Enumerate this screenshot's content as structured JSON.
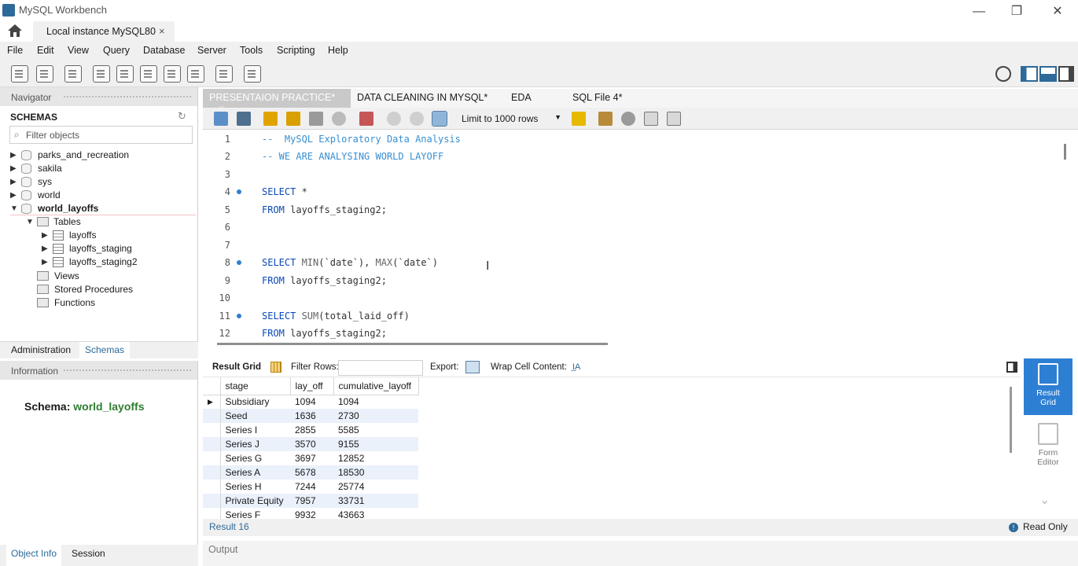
{
  "window": {
    "title": "MySQL Workbench",
    "controls": [
      "—",
      "❐",
      "✕"
    ]
  },
  "connection_tab": {
    "label": "Local instance MySQL80",
    "close": "×"
  },
  "menu": [
    "File",
    "Edit",
    "View",
    "Query",
    "Database",
    "Server",
    "Tools",
    "Scripting",
    "Help"
  ],
  "navigator": {
    "header": "Navigator",
    "schemas_label": "SCHEMAS",
    "filter_placeholder": "Filter objects",
    "schemas": [
      "parks_and_recreation",
      "sakila",
      "sys",
      "world",
      "world_layoffs"
    ],
    "selected_schema": "world_layoffs",
    "children": {
      "tables": "Tables",
      "views": "Views",
      "procedures": "Stored Procedures",
      "functions": "Functions"
    },
    "tables": [
      "layoffs",
      "layoffs_staging",
      "layoffs_staging2"
    ]
  },
  "subtabs": {
    "administration": "Administration",
    "schemas": "Schemas"
  },
  "information": {
    "header": "Information",
    "schema_label": "Schema:",
    "schema_value": "world_layoffs"
  },
  "bottom_tabs": {
    "object_info": "Object Info",
    "session": "Session"
  },
  "editor_tabs": [
    "PRESENTAION PRACTICE*",
    "DATA CLEANING IN MYSQL*",
    "EDA",
    "SQL File 4*"
  ],
  "sql_toolbar": {
    "limit_label": "Limit to 1000 rows"
  },
  "code_lines": [
    {
      "n": "1",
      "dot": false,
      "parts": [
        [
          "cm",
          "--  MySQL Exploratory Data Analysis"
        ]
      ]
    },
    {
      "n": "2",
      "dot": false,
      "parts": [
        [
          "cm",
          "-- WE ARE ANALYSING WORLD LAYOFF"
        ]
      ]
    },
    {
      "n": "3",
      "dot": false,
      "parts": []
    },
    {
      "n": "4",
      "dot": true,
      "parts": [
        [
          "kw",
          "SELECT"
        ],
        [
          "str",
          " *"
        ]
      ]
    },
    {
      "n": "5",
      "dot": false,
      "parts": [
        [
          "kw",
          "FROM"
        ],
        [
          "str",
          " layoffs_staging2;"
        ]
      ]
    },
    {
      "n": "6",
      "dot": false,
      "parts": []
    },
    {
      "n": "7",
      "dot": false,
      "parts": []
    },
    {
      "n": "8",
      "dot": true,
      "parts": [
        [
          "kw",
          "SELECT "
        ],
        [
          "fn",
          "MIN"
        ],
        [
          "str",
          "(`date`), "
        ],
        [
          "fn",
          "MAX"
        ],
        [
          "str",
          "(`date`)"
        ]
      ]
    },
    {
      "n": "9",
      "dot": false,
      "parts": [
        [
          "kw",
          "FROM"
        ],
        [
          "str",
          " layoffs_staging2;"
        ]
      ]
    },
    {
      "n": "10",
      "dot": false,
      "parts": []
    },
    {
      "n": "11",
      "dot": true,
      "parts": [
        [
          "kw",
          "SELECT "
        ],
        [
          "fn",
          "SUM"
        ],
        [
          "str",
          "(total_laid_off)"
        ]
      ]
    },
    {
      "n": "12",
      "dot": false,
      "parts": [
        [
          "kw",
          "FROM"
        ],
        [
          "str",
          " layoffs_staging2;"
        ]
      ]
    }
  ],
  "result_toolbar": {
    "result_grid": "Result Grid",
    "filter_rows": "Filter Rows:",
    "export": "Export:",
    "wrap": "Wrap Cell Content:"
  },
  "result": {
    "columns": [
      "stage",
      "lay_off",
      "cumulative_layoff"
    ],
    "rows": [
      [
        "Subsidiary",
        "1094",
        "1094"
      ],
      [
        "Seed",
        "1636",
        "2730"
      ],
      [
        "Series I",
        "2855",
        "5585"
      ],
      [
        "Series J",
        "3570",
        "9155"
      ],
      [
        "Series G",
        "3697",
        "12852"
      ],
      [
        "Series A",
        "5678",
        "18530"
      ],
      [
        "Series H",
        "7244",
        "25774"
      ],
      [
        "Private Equity",
        "7957",
        "33731"
      ],
      [
        "Series F",
        "9932",
        "43663"
      ]
    ]
  },
  "right_panel": {
    "result_grid_line1": "Result",
    "result_grid_line2": "Grid",
    "form_editor_line1": "Form",
    "form_editor_line2": "Editor"
  },
  "result_tab": "Result 16",
  "status": {
    "read_only": "Read Only"
  },
  "output": "Output"
}
